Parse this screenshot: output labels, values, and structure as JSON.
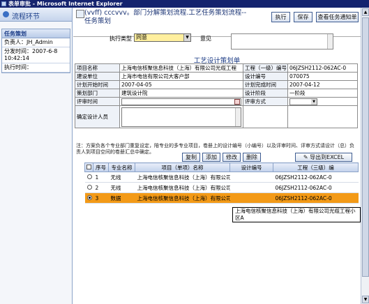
{
  "window": {
    "title": "表单审批 - Microsoft Internet Explorer"
  },
  "sidebar": {
    "header": "流程环节",
    "card": {
      "title": "任务策划",
      "owner": "负责人：JH_Admin",
      "dispatch_label": "分发时间：2007-6-8",
      "dispatch_time": "10:42:14",
      "exec_label": "执行时间："
    }
  },
  "header": {
    "title": "(vvff) cccvvv。部门分解策划流程.工艺任务策划流程--任务策划",
    "buttons": {
      "execute": "执行",
      "save": "保存",
      "view_notice": "查看任务通知单"
    }
  },
  "exec": {
    "type_label": "执行类型",
    "type_value": "同意",
    "opinion_label": "意见"
  },
  "form": {
    "title": "工艺设计策划单",
    "rows": [
      {
        "l1": "项目名称",
        "v1": "上海电信核聚信息科技（上海）有限公司光缆工程",
        "l2": "工程（一级）编号",
        "v2": "06JZSH2112-062AC-0"
      },
      {
        "l1": "建设单位",
        "v1": "上海市电信有限公司大客户部",
        "l2": "设计编号",
        "v2": "070075"
      },
      {
        "l1": "计划开始时间",
        "v1": "2007-04-05",
        "l2": "计划完成时间",
        "v2": "2007-04-12"
      },
      {
        "l1": "策划部门",
        "v1": "建筑设计院",
        "l2": "设计阶段",
        "v2": "一阶段"
      }
    ],
    "review_time_label": "评审时间",
    "review_method_label": "评审方式",
    "designer_label": "确定设计人员",
    "note": "注：方案负各个专业部门重复设定，陪专业的多专业项目，卷册上的设计编号（小编号）以及评审时间、评审方式请设计（总）负责人到项目空间的卷册汇总中确定。"
  },
  "actions": {
    "copy": "复制",
    "add": "添加",
    "edit": "修改",
    "delete": "删除",
    "export": "导出到EXCEL"
  },
  "grid": {
    "columns": [
      "序号",
      "专业名称",
      "项目（单项）名称",
      "设计编号",
      "工程（三级）编"
    ],
    "rows": [
      {
        "no": "1",
        "major": "无线",
        "name": "上海电信核聚信息科技（上海）有限公司光缆工程",
        "design_no": "",
        "code": "06JZSH2112-062AC-0"
      },
      {
        "no": "2",
        "major": "无线",
        "name": "上海电信核聚信息科技（上海）有限公司光缆工程",
        "design_no": "",
        "code": "06JZSH2112-062AC-0"
      },
      {
        "no": "3",
        "major": "数据",
        "name": "上海电信核聚信息科技（上海）有限公司光缆工程",
        "design_no": "",
        "code": "06JZSH2112-062AC-0"
      }
    ],
    "tooltip": "上海电信核聚信息科技（上海）有限公司光缆工程小区A"
  },
  "colors": {
    "selected_row": "#f39a17",
    "title_bar": "#14236e",
    "exec_select_bg": "#ffef9e"
  }
}
